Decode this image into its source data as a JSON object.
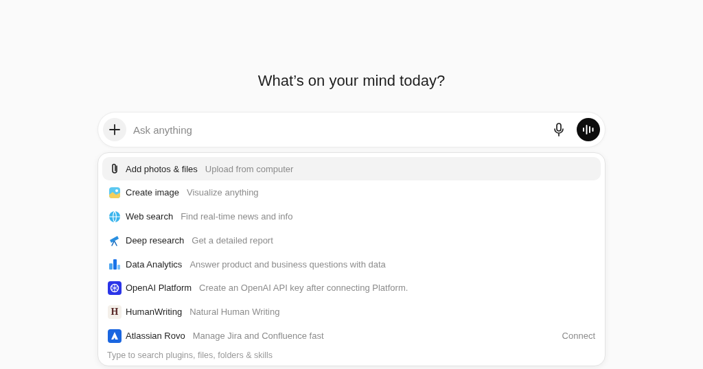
{
  "heading": "What’s on your mind today?",
  "composer": {
    "placeholder": "Ask anything"
  },
  "menu": {
    "items": [
      {
        "kind": "paperclip",
        "title": "Add photos & files",
        "description": "Upload from computer",
        "selected": true
      },
      {
        "kind": "image",
        "title": "Create image",
        "description": "Visualize anything",
        "selected": false
      },
      {
        "kind": "globe",
        "title": "Web search",
        "description": "Find real-time news and info",
        "selected": false
      },
      {
        "kind": "telescope",
        "title": "Deep research",
        "description": "Get a detailed report",
        "selected": false
      },
      {
        "kind": "chart",
        "title": "Data Analytics",
        "description": "Answer product and business questions with data",
        "selected": false
      },
      {
        "kind": "openai",
        "title": "OpenAI Platform",
        "description": "Create an OpenAI API key after connecting Platform.",
        "selected": false
      },
      {
        "kind": "letter",
        "badge": "H",
        "title": "HumanWriting",
        "description": "Natural Human Writing",
        "selected": false
      },
      {
        "kind": "atlassian",
        "title": "Atlassian Rovo",
        "description": "Manage Jira and Confluence fast",
        "selected": false,
        "action": "Connect"
      }
    ],
    "hint": "Type to search plugins, files, folders & skills"
  }
}
